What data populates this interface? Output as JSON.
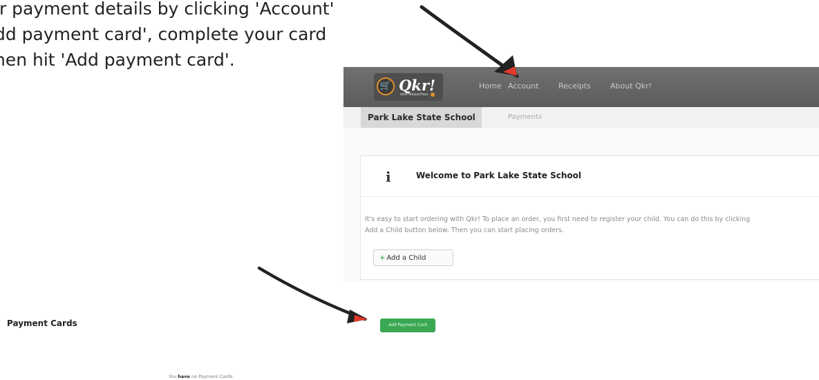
{
  "instructions": "ir payment details by clicking 'Account'\ndd payment card', complete your card\nhen hit 'Add payment card'.",
  "app": {
    "logo_text": "Qkr!",
    "logo_sub": "with MasterPass",
    "nav": [
      "Home",
      "Account",
      "Receipts",
      "About Qkr!"
    ]
  },
  "subnav": {
    "active_tab": "Park Lake State School",
    "other_tab": "Payments"
  },
  "welcome": {
    "prefix": "Welcome to",
    "school": "Park Lake State School",
    "body": "It's easy to start ordering with Qkr! To place an order, you first need to register your child. You can do this by clicking\nAdd a Child button below. Then you can start placing orders.",
    "add_child_label": "Add a Child"
  },
  "payment_cards": {
    "title": "Payment Cards",
    "add_button_label": "Add Payment Card",
    "empty_prefix": "You",
    "empty_bold": "have",
    "empty_suffix": "no Payment Cards."
  },
  "colors": {
    "navbar": "#5c5c5c",
    "accent_green": "#3aa853",
    "arrow": "#222222",
    "arrow_tip": "#e23a2a"
  }
}
